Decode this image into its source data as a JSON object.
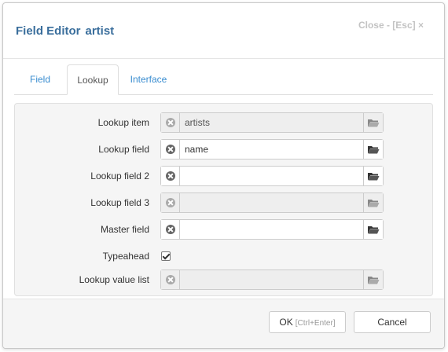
{
  "header": {
    "title": "Field Editor",
    "field_name": "artist",
    "close": "Close - [Esc] ×"
  },
  "tabs": [
    {
      "label": "Field",
      "active": false
    },
    {
      "label": "Lookup",
      "active": true
    },
    {
      "label": "Interface",
      "active": false
    }
  ],
  "form": {
    "lookup_item": {
      "label": "Lookup item",
      "value": "artists",
      "disabled": true
    },
    "lookup_field": {
      "label": "Lookup field",
      "value": "name",
      "disabled": false
    },
    "lookup_field2": {
      "label": "Lookup field 2",
      "value": "",
      "disabled": false
    },
    "lookup_field3": {
      "label": "Lookup field 3",
      "value": "",
      "disabled": true
    },
    "master_field": {
      "label": "Master field",
      "value": "",
      "disabled": false
    },
    "typeahead": {
      "label": "Typeahead",
      "checked": true
    },
    "lookup_value_list": {
      "label": "Lookup value list",
      "value": "",
      "disabled": true
    }
  },
  "footer": {
    "ok_label": "OK",
    "ok_hint": "[Ctrl+Enter]",
    "cancel_label": "Cancel"
  },
  "icons": {
    "clear": "clear-x-icon",
    "open": "folder-open-icon"
  },
  "colors": {
    "title": "#3a6e9c",
    "tab_link": "#3a8dd0",
    "close": "#c3c3c3"
  }
}
